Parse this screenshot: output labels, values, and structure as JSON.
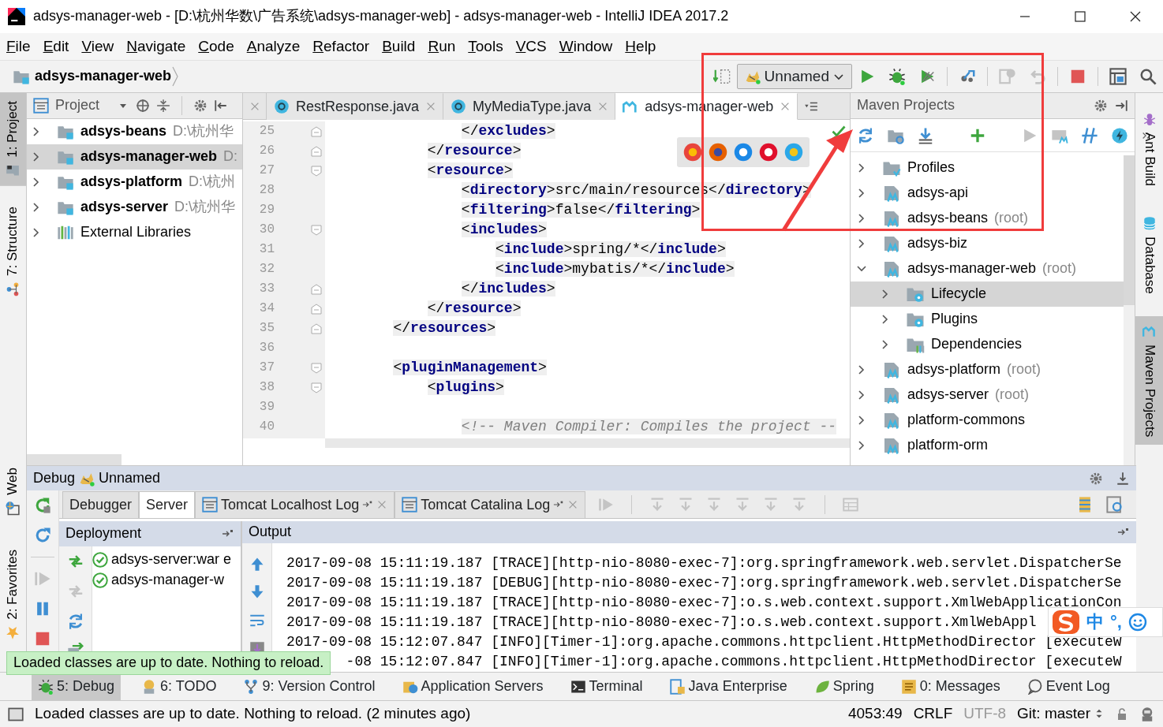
{
  "window": {
    "title": "adsys-manager-web - [D:\\杭州华数\\广告系统\\adsys-manager-web] - adsys-manager-web - IntelliJ IDEA 2017.2"
  },
  "menu": [
    "File",
    "Edit",
    "View",
    "Navigate",
    "Code",
    "Analyze",
    "Refactor",
    "Build",
    "Run",
    "Tools",
    "VCS",
    "Window",
    "Help"
  ],
  "breadcrumb": "adsys-manager-web",
  "run_config": "Unnamed",
  "left_stripe": [
    {
      "label": "1: Project",
      "kind": "project",
      "selected": true
    },
    {
      "label": "7: Structure",
      "kind": "structure",
      "selected": false
    }
  ],
  "left_stripe_bottom": [
    {
      "label": "Web",
      "kind": "web",
      "selected": false
    },
    {
      "label": "2: Favorites",
      "kind": "favorites",
      "selected": false
    }
  ],
  "project_panel": {
    "title": "Project",
    "items": [
      {
        "kind": "module",
        "name": "adsys-beans",
        "path": "D:\\杭州华",
        "selected": false
      },
      {
        "kind": "module",
        "name": "adsys-manager-web",
        "path": "D:",
        "selected": true
      },
      {
        "kind": "module",
        "name": "adsys-platform",
        "path": "D:\\杭州",
        "selected": false
      },
      {
        "kind": "module",
        "name": "adsys-server",
        "path": "D:\\杭州华",
        "selected": false
      },
      {
        "kind": "library",
        "name": "External Libraries",
        "selected": false
      }
    ]
  },
  "editor_tabs": [
    {
      "label": "RestResponse.java",
      "kind": "class",
      "selected": false
    },
    {
      "label": "MyMediaType.java",
      "kind": "class",
      "selected": false
    },
    {
      "label": "adsys-manager-web",
      "kind": "maven",
      "selected": true
    }
  ],
  "editor": {
    "lines": [
      {
        "number": "25",
        "code": "                </excludes>",
        "fold_start": false,
        "fold_end": true
      },
      {
        "number": "26",
        "code": "            </resource>",
        "fold_start": false,
        "fold_end": true
      },
      {
        "number": "27",
        "code": "            <resource>",
        "fold_start": true,
        "fold_end": false
      },
      {
        "number": "28",
        "code": "                <directory>src/main/resources</directory>",
        "fold_start": false,
        "fold_end": false
      },
      {
        "number": "29",
        "code": "                <filtering>false</filtering>",
        "fold_start": false,
        "fold_end": false
      },
      {
        "number": "30",
        "code": "                <includes>",
        "fold_start": true,
        "fold_end": false
      },
      {
        "number": "31",
        "code": "                    <include>spring/*</include>",
        "fold_start": false,
        "fold_end": false
      },
      {
        "number": "32",
        "code": "                    <include>mybatis/*</include>",
        "fold_start": false,
        "fold_end": false
      },
      {
        "number": "33",
        "code": "                </includes>",
        "fold_start": false,
        "fold_end": true
      },
      {
        "number": "34",
        "code": "            </resource>",
        "fold_start": false,
        "fold_end": true
      },
      {
        "number": "35",
        "code": "        </resources>",
        "fold_start": false,
        "fold_end": true
      },
      {
        "number": "36",
        "fold_start": false,
        "fold_end": false
      },
      {
        "number": "37",
        "code": "        <pluginManagement>",
        "fold_start": true,
        "fold_end": false
      },
      {
        "number": "38",
        "code": "            <plugins>",
        "fold_start": true,
        "fold_end": false
      },
      {
        "number": "39",
        "fold_start": false,
        "fold_end": false
      },
      {
        "number": "40",
        "code": "                <!-- Maven Compiler: Compiles the project --",
        "kind": "comment",
        "fold_start": false,
        "fold_end": false
      }
    ]
  },
  "maven": {
    "title": "Maven Projects",
    "items": [
      {
        "kind": "profiles",
        "name": "Profiles",
        "expanded": false,
        "selected": false
      },
      {
        "kind": "module",
        "name": "adsys-api",
        "expanded": false,
        "selected": false
      },
      {
        "kind": "module",
        "name": "adsys-beans",
        "note": "(root)",
        "expanded": false,
        "selected": false
      },
      {
        "kind": "module",
        "name": "adsys-biz",
        "expanded": false,
        "selected": false
      },
      {
        "kind": "module",
        "name": "adsys-manager-web",
        "note": "(root)",
        "expanded": true,
        "selected": false,
        "children": [
          {
            "kind": "lifecycle",
            "name": "Lifecycle",
            "expanded": false,
            "selected": true
          },
          {
            "kind": "plugins",
            "name": "Plugins",
            "expanded": false,
            "selected": false
          },
          {
            "kind": "dependencies",
            "name": "Dependencies",
            "expanded": false,
            "selected": false
          }
        ]
      },
      {
        "kind": "module",
        "name": "adsys-platform",
        "note": "(root)",
        "expanded": false,
        "selected": false
      },
      {
        "kind": "module",
        "name": "adsys-server",
        "note": "(root)",
        "expanded": false,
        "selected": false
      },
      {
        "kind": "module",
        "name": "platform-commons",
        "expanded": false,
        "selected": false
      },
      {
        "kind": "module",
        "name": "platform-orm",
        "expanded": false,
        "selected": false
      }
    ]
  },
  "right_stripe": [
    {
      "label": "Ant Build",
      "kind": "ant",
      "selected": false
    },
    {
      "label": "Database",
      "kind": "database",
      "selected": false
    },
    {
      "label": "Maven Projects",
      "kind": "maven",
      "selected": true
    }
  ],
  "debug": {
    "title": "Debug",
    "config": "Unnamed",
    "tabs": [
      {
        "label": "Debugger",
        "kind": "plain",
        "selected": false
      },
      {
        "label": "Server",
        "kind": "plain",
        "selected": true
      },
      {
        "label": "Tomcat Localhost Log",
        "kind": "log",
        "selected": false
      },
      {
        "label": "Tomcat Catalina Log",
        "kind": "log",
        "selected": false
      }
    ],
    "deployment_title": "Deployment",
    "output_title": "Output",
    "deployments": [
      {
        "name": "adsys-server:war e"
      },
      {
        "name": "adsys-manager-w"
      }
    ],
    "log": [
      {
        "text": "2017-09-08 15:11:19.187 [TRACE][http-nio-8080-exec-7]:org.springframework.web.servlet.DispatcherSe"
      },
      {
        "text": "2017-09-08 15:11:19.187 [DEBUG][http-nio-8080-exec-7]:org.springframework.web.servlet.DispatcherSe"
      },
      {
        "text": "2017-09-08 15:11:19.187 [TRACE][http-nio-8080-exec-7]:o.s.web.context.support.XmlWebApplicationCon"
      },
      {
        "text": "2017-09-08 15:11:19.187 [TRACE][http-nio-8080-exec-7]:o.s.web.context.support.XmlWebAppl"
      },
      {
        "text": "2017-09-08 15:12:07.847 [INFO][Timer-1]:org.apache.commons.httpclient.HttpMethodDirector [executeW"
      },
      {
        "text": "-08 15:12:07.847 [INFO][Timer-1]:org.apache.commons.httpclient.HttpMethodDirector [executeW",
        "kind": "covered"
      }
    ]
  },
  "tooltip": "Loaded classes are up to date. Nothing to reload.",
  "ime": {
    "mode": "中",
    "punctuation": "°,"
  },
  "tool_windows": [
    {
      "label": "5: Debug",
      "kind": "debug",
      "selected": true
    },
    {
      "label": "6: TODO",
      "kind": "todo",
      "selected": false
    },
    {
      "label": "9: Version Control",
      "kind": "vcs",
      "selected": false
    },
    {
      "label": "Application Servers",
      "kind": "servers",
      "selected": false
    },
    {
      "label": "Terminal",
      "kind": "terminal",
      "selected": false
    },
    {
      "label": "Java Enterprise",
      "kind": "javaee",
      "selected": false
    },
    {
      "label": "Spring",
      "kind": "spring",
      "selected": false
    },
    {
      "label": "0: Messages",
      "kind": "messages",
      "selected": false
    },
    {
      "label": "Event Log",
      "kind": "eventlog",
      "selected": false
    }
  ],
  "status_bar": {
    "message": "Loaded classes are up to date. Nothing to reload. (2 minutes ago)",
    "position": "4053:49",
    "line_separator": "CRLF",
    "encoding": "UTF-8",
    "encoding_disabled": true,
    "vcs": "Git: master"
  }
}
